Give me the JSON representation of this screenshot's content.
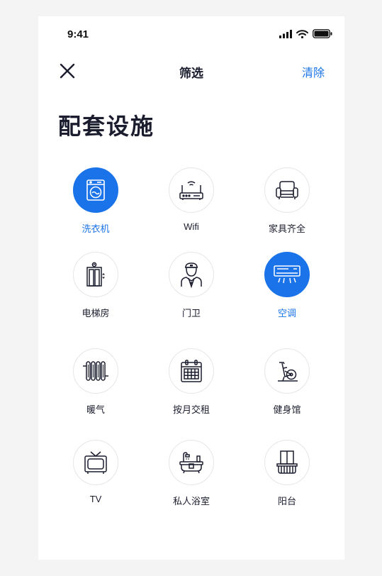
{
  "status_bar": {
    "time": "9:41",
    "icons": [
      "signal-icon",
      "wifi-icon",
      "battery-icon"
    ]
  },
  "nav": {
    "close_icon": "close-icon",
    "title": "筛选",
    "clear_label": "清除"
  },
  "page_title": "配套设施",
  "colors": {
    "accent": "#1a73e8",
    "text_dark": "#1b1d2e",
    "circle_border": "#e6e6ea"
  },
  "facilities": [
    {
      "label": "洗衣机",
      "icon": "washing-machine-icon",
      "selected": true
    },
    {
      "label": "Wifi",
      "icon": "router-icon",
      "selected": false
    },
    {
      "label": "家具齐全",
      "icon": "sofa-icon",
      "selected": false
    },
    {
      "label": "电梯房",
      "icon": "elevator-icon",
      "selected": false
    },
    {
      "label": "门卫",
      "icon": "doorman-icon",
      "selected": false
    },
    {
      "label": "空调",
      "icon": "air-conditioner-icon",
      "selected": true
    },
    {
      "label": "暖气",
      "icon": "radiator-icon",
      "selected": false
    },
    {
      "label": "按月交租",
      "icon": "calendar-icon",
      "selected": false
    },
    {
      "label": "健身馆",
      "icon": "exercise-bike-icon",
      "selected": false
    },
    {
      "label": "TV",
      "icon": "tv-icon",
      "selected": false
    },
    {
      "label": "私人浴室",
      "icon": "bathtub-icon",
      "selected": false
    },
    {
      "label": "阳台",
      "icon": "balcony-icon",
      "selected": false
    }
  ]
}
